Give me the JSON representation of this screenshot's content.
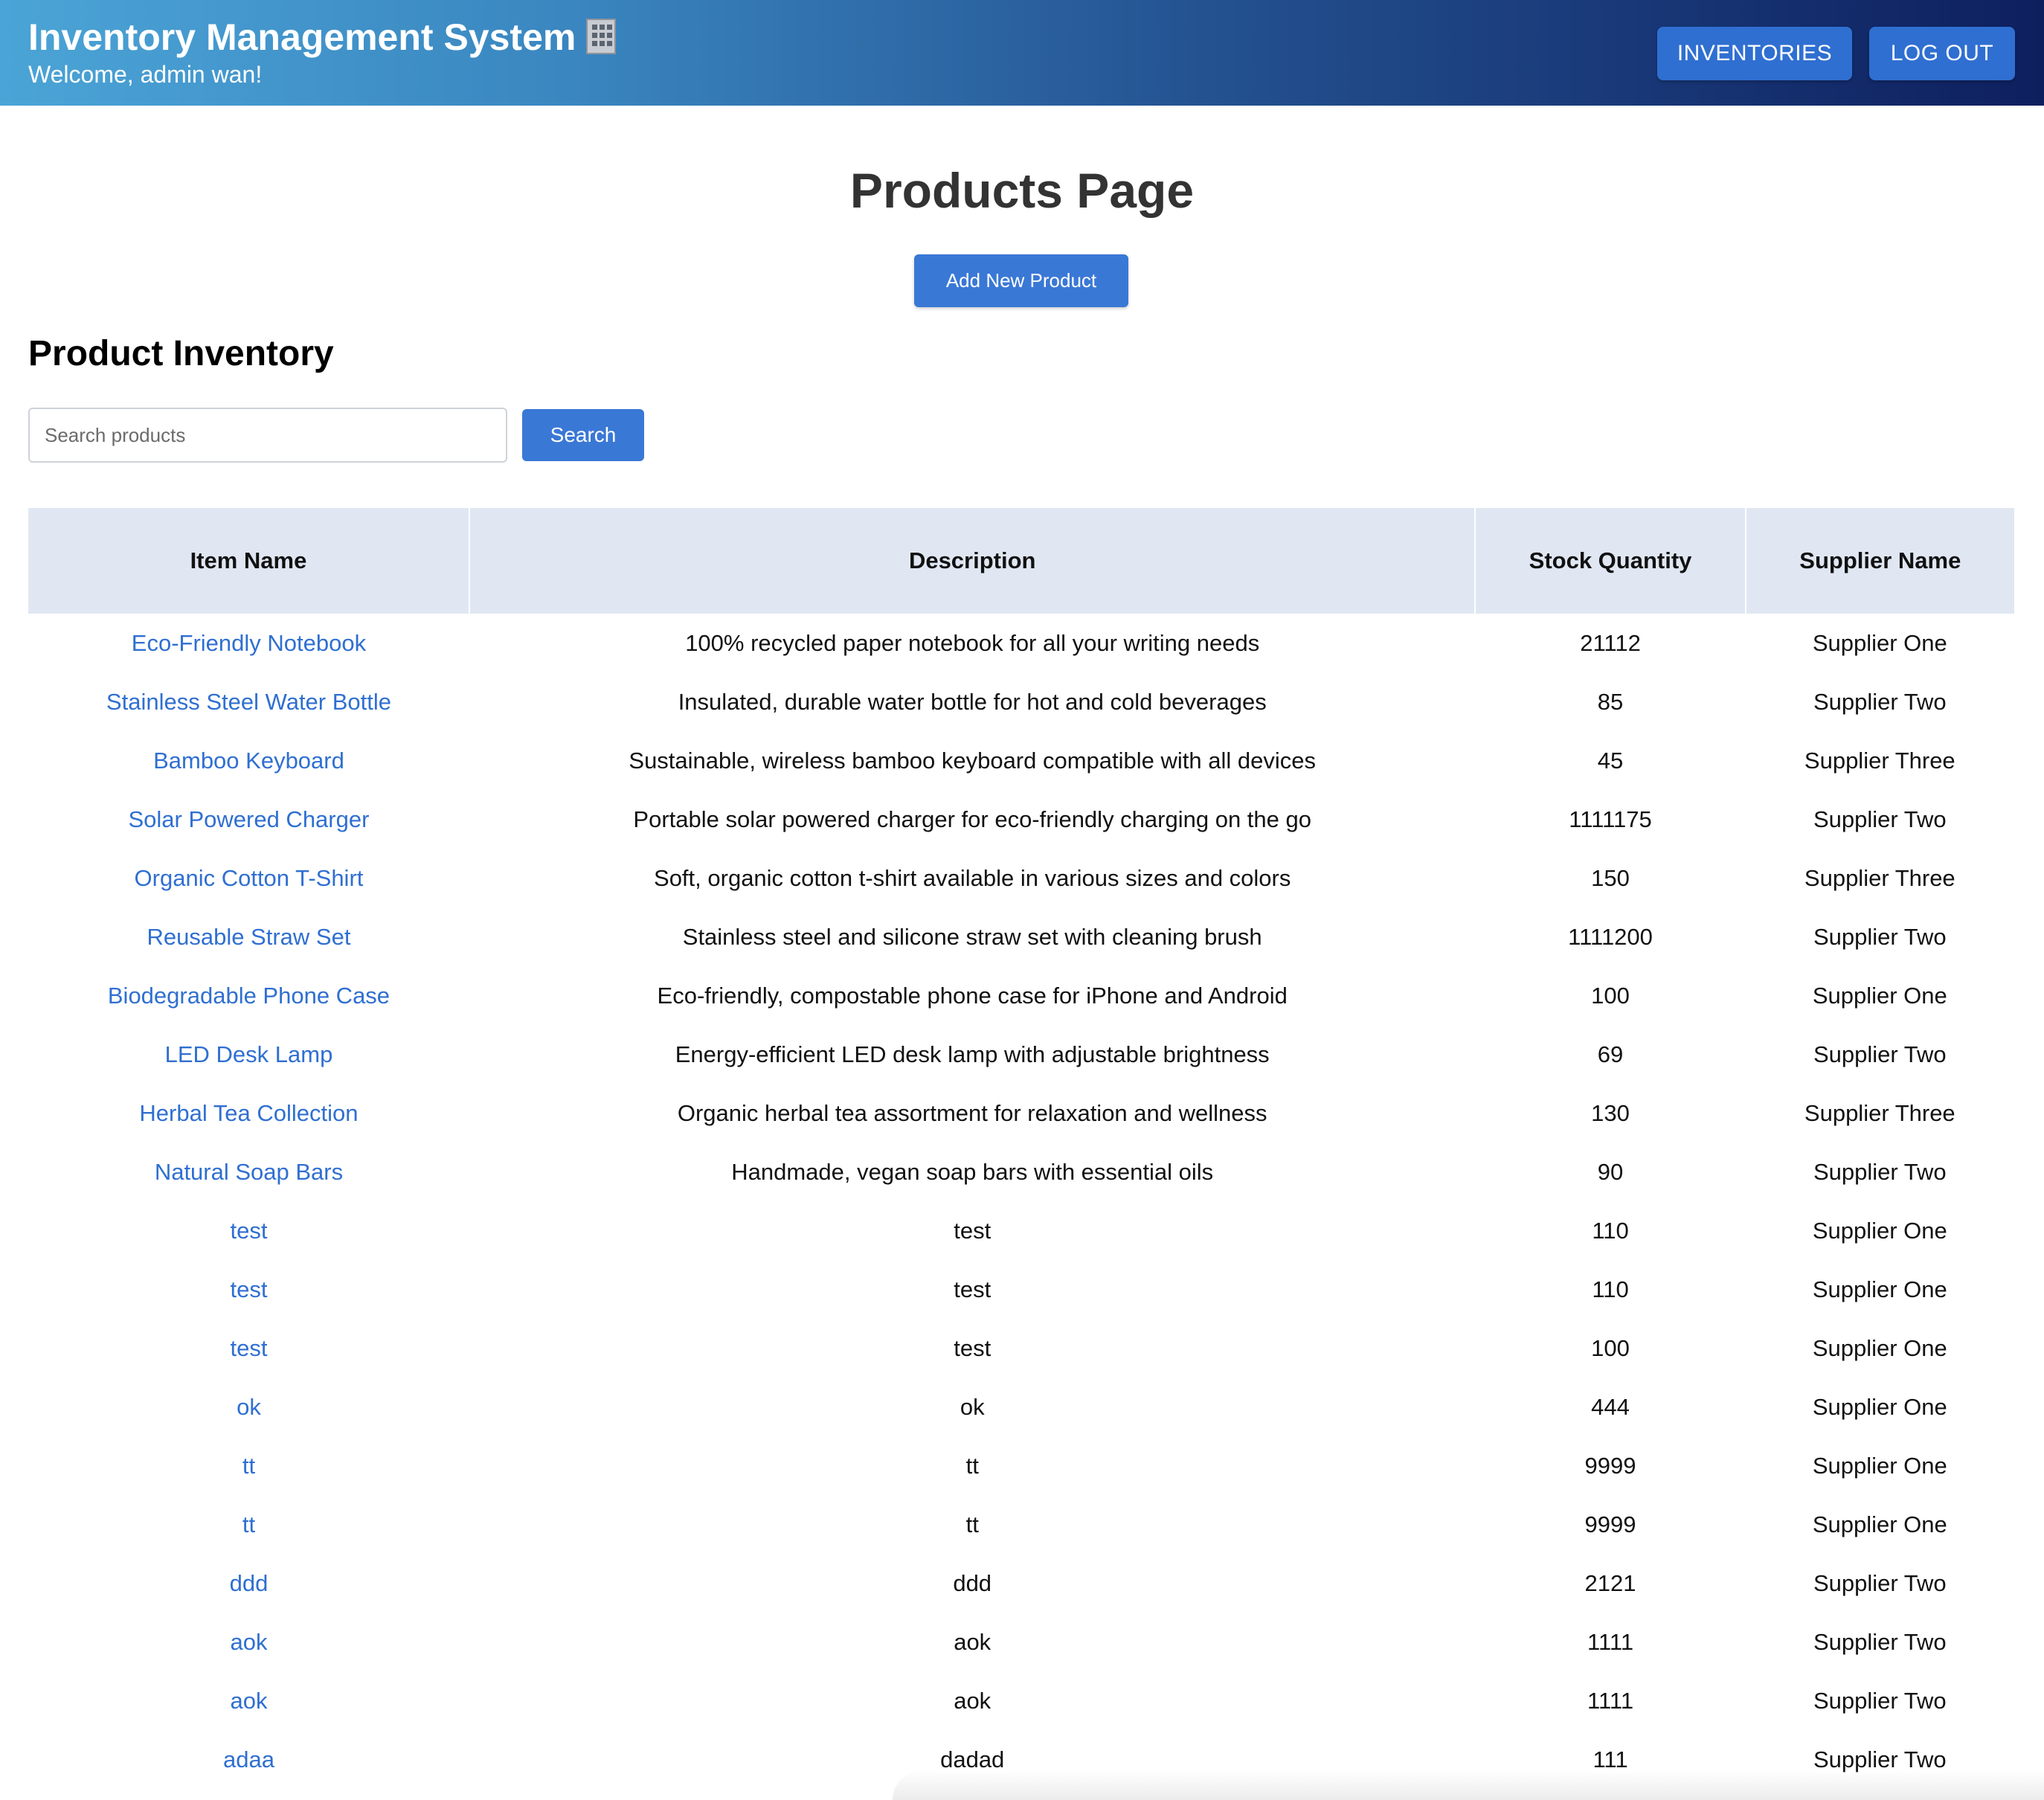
{
  "header": {
    "title": "Inventory Management System",
    "welcome": "Welcome, admin wan!",
    "buttons": {
      "inventories": "INVENTORIES",
      "logout": "LOG OUT"
    },
    "gradient_colors": [
      "#4ba4d6",
      "#0e1f5e"
    ]
  },
  "page": {
    "title": "Products Page",
    "add_button": "Add New Product",
    "section_title": "Product Inventory"
  },
  "search": {
    "placeholder": "Search products",
    "value": "",
    "button": "Search"
  },
  "table": {
    "columns": [
      "Item Name",
      "Description",
      "Stock Quantity",
      "Supplier Name"
    ],
    "rows": [
      {
        "name": "Eco-Friendly Notebook",
        "description": "100% recycled paper notebook for all your writing needs",
        "stock": "21112",
        "supplier": "Supplier One"
      },
      {
        "name": "Stainless Steel Water Bottle",
        "description": "Insulated, durable water bottle for hot and cold beverages",
        "stock": "85",
        "supplier": "Supplier Two"
      },
      {
        "name": "Bamboo Keyboard",
        "description": "Sustainable, wireless bamboo keyboard compatible with all devices",
        "stock": "45",
        "supplier": "Supplier Three"
      },
      {
        "name": "Solar Powered Charger",
        "description": "Portable solar powered charger for eco-friendly charging on the go",
        "stock": "1111175",
        "supplier": "Supplier Two"
      },
      {
        "name": "Organic Cotton T-Shirt",
        "description": "Soft, organic cotton t-shirt available in various sizes and colors",
        "stock": "150",
        "supplier": "Supplier Three"
      },
      {
        "name": "Reusable Straw Set",
        "description": "Stainless steel and silicone straw set with cleaning brush",
        "stock": "1111200",
        "supplier": "Supplier Two"
      },
      {
        "name": "Biodegradable Phone Case",
        "description": "Eco-friendly, compostable phone case for iPhone and Android",
        "stock": "100",
        "supplier": "Supplier One"
      },
      {
        "name": "LED Desk Lamp",
        "description": "Energy-efficient LED desk lamp with adjustable brightness",
        "stock": "69",
        "supplier": "Supplier Two"
      },
      {
        "name": "Herbal Tea Collection",
        "description": "Organic herbal tea assortment for relaxation and wellness",
        "stock": "130",
        "supplier": "Supplier Three"
      },
      {
        "name": "Natural Soap Bars",
        "description": "Handmade, vegan soap bars with essential oils",
        "stock": "90",
        "supplier": "Supplier Two"
      },
      {
        "name": "test",
        "description": "test",
        "stock": "110",
        "supplier": "Supplier One"
      },
      {
        "name": "test",
        "description": "test",
        "stock": "110",
        "supplier": "Supplier One"
      },
      {
        "name": "test",
        "description": "test",
        "stock": "100",
        "supplier": "Supplier One"
      },
      {
        "name": "ok",
        "description": "ok",
        "stock": "444",
        "supplier": "Supplier One"
      },
      {
        "name": "tt",
        "description": "tt",
        "stock": "9999",
        "supplier": "Supplier One"
      },
      {
        "name": "tt",
        "description": "tt",
        "stock": "9999",
        "supplier": "Supplier One"
      },
      {
        "name": "ddd",
        "description": "ddd",
        "stock": "2121",
        "supplier": "Supplier Two"
      },
      {
        "name": "aok",
        "description": "aok",
        "stock": "1111",
        "supplier": "Supplier Two"
      },
      {
        "name": "aok",
        "description": "aok",
        "stock": "1111",
        "supplier": "Supplier Two"
      },
      {
        "name": "adaa",
        "description": "dadad",
        "stock": "111",
        "supplier": "Supplier Two"
      }
    ]
  },
  "icons": {
    "title_icon": "office-building-icon"
  },
  "colors": {
    "accent": "#3a78d6",
    "link": "#2f6fd1",
    "table_header_bg": "#e0e7f3"
  }
}
